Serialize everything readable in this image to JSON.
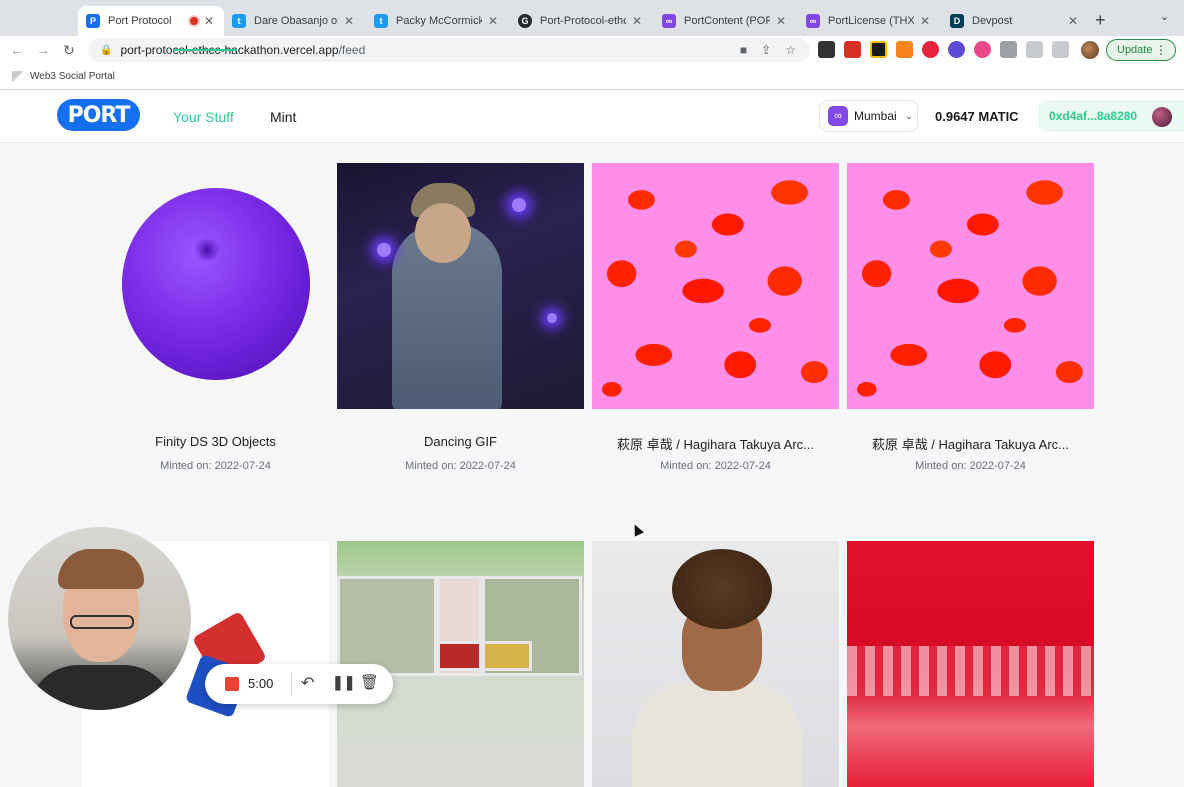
{
  "browser": {
    "tabs": [
      {
        "title": "Port Protocol",
        "favicon_color": "#1570ef",
        "favicon_glyph": "P",
        "active": true,
        "recording": true
      },
      {
        "title": "Dare Obasanjo on T",
        "favicon_color": "#1d9bf0",
        "favicon_glyph": "t",
        "active": false
      },
      {
        "title": "Packy McCormick o",
        "favicon_color": "#1d9bf0",
        "favicon_glyph": "t",
        "active": false
      },
      {
        "title": "Port-Protocol-ethc",
        "favicon_color": "#24292e",
        "favicon_glyph": "G",
        "active": false
      },
      {
        "title": "PortContent (PORT",
        "favicon_color": "#8247e5",
        "favicon_glyph": "∞",
        "active": false
      },
      {
        "title": "PortLicense (THX)",
        "favicon_color": "#8247e5",
        "favicon_glyph": "∞",
        "active": false
      },
      {
        "title": "Devpost",
        "favicon_color": "#003e54",
        "favicon_glyph": "D",
        "active": false
      }
    ],
    "url_host": "port-protocol-ethcc-hackathon.vercel.app",
    "url_path": "/feed",
    "update_label": "Update",
    "bookmark": "Web3 Social Portal"
  },
  "app": {
    "logo": "PORT",
    "nav": {
      "your_stuff": "Your Stuff",
      "mint": "Mint",
      "active": "your_stuff"
    },
    "network": "Mumbai",
    "balance": "0.9647 MATIC",
    "wallet": "0xd4af...8a8280",
    "accent": "#2ecc8f",
    "brand": "#1570ef"
  },
  "feed": [
    {
      "title": "Finity DS 3D Objects",
      "date": "Minted on: 2022-07-24",
      "kind": "blob"
    },
    {
      "title": "Dancing GIF",
      "date": "Minted on: 2022-07-24",
      "kind": "gif"
    },
    {
      "title": "萩原 卓哉 / Hagihara Takuya Arc...",
      "date": "Minted on: 2022-07-24",
      "kind": "pattern"
    },
    {
      "title": "萩原 卓哉 / Hagihara Takuya Arc...",
      "date": "Minted on: 2022-07-24",
      "kind": "pattern"
    },
    {
      "kind": "lego"
    },
    {
      "kind": "building"
    },
    {
      "kind": "kid"
    },
    {
      "kind": "red"
    }
  ],
  "recorder": {
    "time": "5:00"
  }
}
